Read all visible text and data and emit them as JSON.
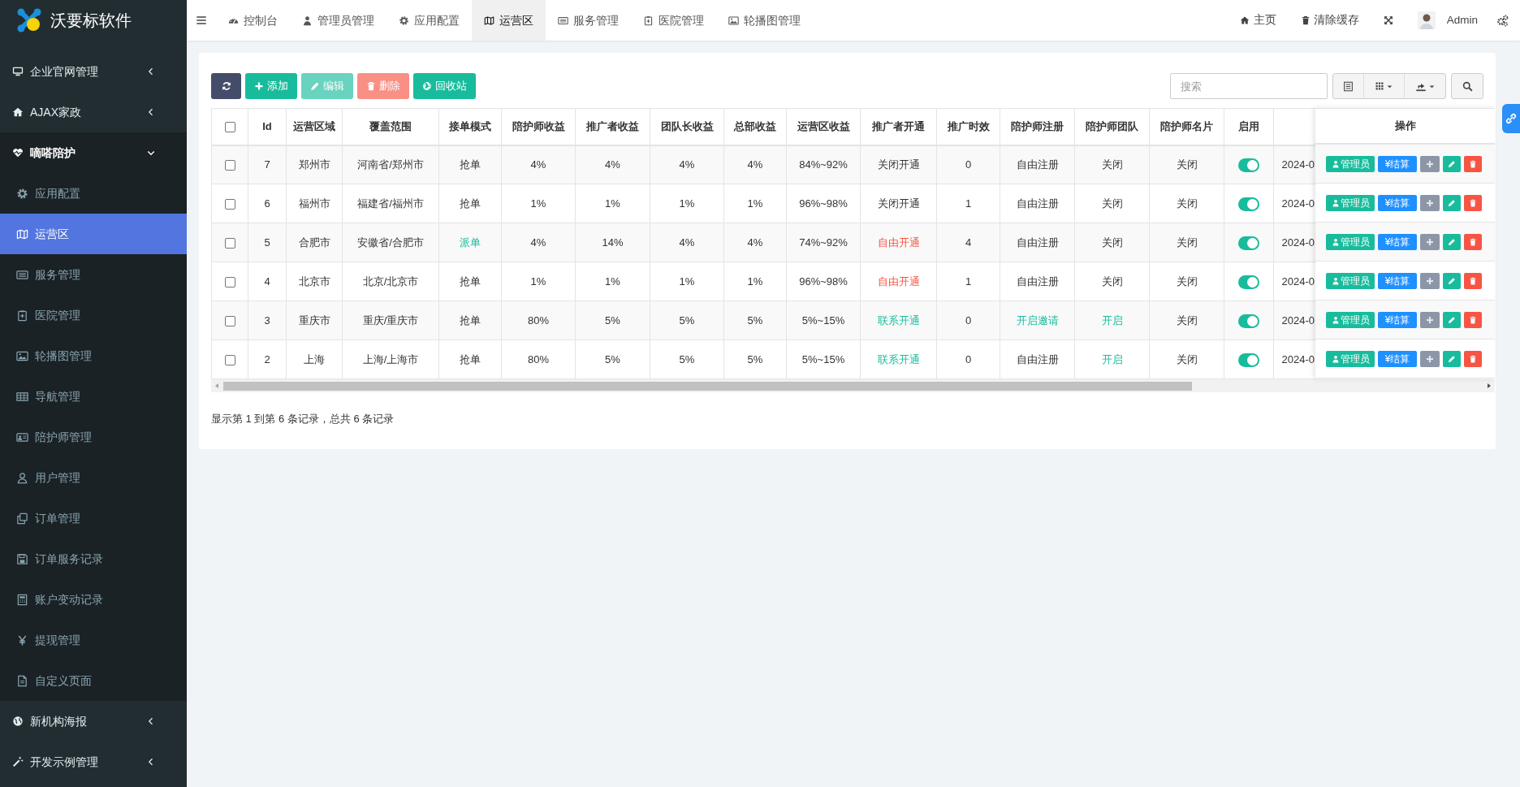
{
  "sidebar": {
    "logo_text": "沃要标软件",
    "items": [
      {
        "label": "企业官网管理",
        "expanded": false
      },
      {
        "label": "AJAX家政",
        "expanded": false
      },
      {
        "label": "嘀嗒陪护",
        "expanded": true,
        "children": [
          {
            "label": "应用配置",
            "selected": false
          },
          {
            "label": "运营区",
            "selected": true
          },
          {
            "label": "服务管理",
            "selected": false
          },
          {
            "label": "医院管理",
            "selected": false
          },
          {
            "label": "轮播图管理",
            "selected": false
          },
          {
            "label": "导航管理",
            "selected": false
          },
          {
            "label": "陪护师管理",
            "selected": false
          },
          {
            "label": "用户管理",
            "selected": false
          },
          {
            "label": "订单管理",
            "selected": false
          },
          {
            "label": "订单服务记录",
            "selected": false
          },
          {
            "label": "账户变动记录",
            "selected": false
          },
          {
            "label": "提现管理",
            "selected": false
          },
          {
            "label": "自定义页面",
            "selected": false
          }
        ]
      },
      {
        "label": "新机构海报",
        "expanded": false
      },
      {
        "label": "开发示例管理",
        "expanded": false
      }
    ]
  },
  "tabs": [
    {
      "label": "控制台",
      "selected": false
    },
    {
      "label": "管理员管理",
      "selected": false
    },
    {
      "label": "应用配置",
      "selected": false
    },
    {
      "label": "运营区",
      "selected": true
    },
    {
      "label": "服务管理",
      "selected": false
    },
    {
      "label": "医院管理",
      "selected": false
    },
    {
      "label": "轮播图管理",
      "selected": false
    }
  ],
  "top_right": {
    "home": "主页",
    "clear_cache": "清除缓存",
    "user": "Admin"
  },
  "toolbar": {
    "buttons": [
      {
        "kind": "refresh",
        "disabled": false
      },
      {
        "kind": "add",
        "label": "添加",
        "disabled": false
      },
      {
        "kind": "edit",
        "label": "编辑",
        "disabled": true
      },
      {
        "kind": "delete",
        "label": "删除",
        "disabled": true
      },
      {
        "kind": "recycle",
        "label": "回收站",
        "disabled": false
      }
    ],
    "search": {
      "placeholder": "搜索"
    }
  },
  "table": {
    "header_checked": false,
    "columns": [
      "Id",
      "运营区域",
      "覆盖范围",
      "接单模式",
      "陪护师收益",
      "推广者收益",
      "团队长收益",
      "总部收益",
      "运营区收益",
      "推广者开通",
      "推广时效",
      "陪护师注册",
      "陪护师团队",
      "陪护师名片",
      "启用"
    ],
    "actions_heading": "操作",
    "rows": [
      {
        "checked": false,
        "id": "7",
        "region": "郑州市",
        "coverage": "河南省/郑州市",
        "mode": {
          "text": "抢单",
          "color": "#333333"
        },
        "caregiver_income": "4%",
        "promoter_income": "4%",
        "leader_income": "4%",
        "hq_income": "4%",
        "region_income": "84%~92%",
        "promoter_open": {
          "text": "关闭开通",
          "color": "#333333"
        },
        "promotion_period": "0",
        "caregiver_registration": {
          "text": "自由注册",
          "color": "#333333"
        },
        "caregiver_team": {
          "text": "关闭",
          "color": "#333333"
        },
        "caregiver_card": "关闭",
        "enabled": true,
        "column_17": "2024-0",
        "actions": [
          {
            "kind": "admin",
            "label": "管理员"
          },
          {
            "kind": "settle",
            "label": "¥结算"
          },
          {
            "kind": "move"
          },
          {
            "kind": "edit"
          },
          {
            "kind": "delete"
          }
        ]
      },
      {
        "checked": false,
        "id": "6",
        "region": "福州市",
        "coverage": "福建省/福州市",
        "mode": {
          "text": "抢单",
          "color": "#333333"
        },
        "caregiver_income": "1%",
        "promoter_income": "1%",
        "leader_income": "1%",
        "hq_income": "1%",
        "region_income": "96%~98%",
        "promoter_open": {
          "text": "关闭开通",
          "color": "#333333"
        },
        "promotion_period": "1",
        "caregiver_registration": {
          "text": "自由注册",
          "color": "#333333"
        },
        "caregiver_team": {
          "text": "关闭",
          "color": "#333333"
        },
        "caregiver_card": "关闭",
        "enabled": true,
        "column_17": "2024-0",
        "actions": [
          {
            "kind": "admin",
            "label": "管理员"
          },
          {
            "kind": "settle",
            "label": "¥结算"
          },
          {
            "kind": "move"
          },
          {
            "kind": "edit"
          },
          {
            "kind": "delete"
          }
        ]
      },
      {
        "checked": false,
        "id": "5",
        "region": "合肥市",
        "coverage": "安徽省/合肥市",
        "mode": {
          "text": "派单",
          "color": "#18bc9c"
        },
        "caregiver_income": "4%",
        "promoter_income": "14%",
        "leader_income": "4%",
        "hq_income": "4%",
        "region_income": "74%~92%",
        "promoter_open": {
          "text": "自由开通",
          "color": "#f75444"
        },
        "promotion_period": "4",
        "caregiver_registration": {
          "text": "自由注册",
          "color": "#333333"
        },
        "caregiver_team": {
          "text": "关闭",
          "color": "#333333"
        },
        "caregiver_card": "关闭",
        "enabled": true,
        "column_17": "2024-0",
        "actions": [
          {
            "kind": "admin",
            "label": "管理员"
          },
          {
            "kind": "settle",
            "label": "¥结算"
          },
          {
            "kind": "move"
          },
          {
            "kind": "edit"
          },
          {
            "kind": "delete"
          }
        ]
      },
      {
        "checked": false,
        "id": "4",
        "region": "北京市",
        "coverage": "北京/北京市",
        "mode": {
          "text": "抢单",
          "color": "#333333"
        },
        "caregiver_income": "1%",
        "promoter_income": "1%",
        "leader_income": "1%",
        "hq_income": "1%",
        "region_income": "96%~98%",
        "promoter_open": {
          "text": "自由开通",
          "color": "#f75444"
        },
        "promotion_period": "1",
        "caregiver_registration": {
          "text": "自由注册",
          "color": "#333333"
        },
        "caregiver_team": {
          "text": "关闭",
          "color": "#333333"
        },
        "caregiver_card": "关闭",
        "enabled": true,
        "column_17": "2024-0",
        "actions": [
          {
            "kind": "admin",
            "label": "管理员"
          },
          {
            "kind": "settle",
            "label": "¥结算"
          },
          {
            "kind": "move"
          },
          {
            "kind": "edit"
          },
          {
            "kind": "delete"
          }
        ]
      },
      {
        "checked": false,
        "id": "3",
        "region": "重庆市",
        "coverage": "重庆/重庆市",
        "mode": {
          "text": "抢单",
          "color": "#333333"
        },
        "caregiver_income": "80%",
        "promoter_income": "5%",
        "leader_income": "5%",
        "hq_income": "5%",
        "region_income": "5%~15%",
        "promoter_open": {
          "text": "联系开通",
          "color": "#18bc9c"
        },
        "promotion_period": "0",
        "caregiver_registration": {
          "text": "开启邀请",
          "color": "#18bc9c"
        },
        "caregiver_team": {
          "text": "开启",
          "color": "#18bc9c"
        },
        "caregiver_card": "关闭",
        "enabled": true,
        "column_17": "2024-0",
        "actions": [
          {
            "kind": "admin",
            "label": "管理员"
          },
          {
            "kind": "settle",
            "label": "¥结算"
          },
          {
            "kind": "move"
          },
          {
            "kind": "edit"
          },
          {
            "kind": "delete"
          }
        ]
      },
      {
        "checked": false,
        "id": "2",
        "region": "上海",
        "coverage": "上海/上海市",
        "mode": {
          "text": "抢单",
          "color": "#333333"
        },
        "caregiver_income": "80%",
        "promoter_income": "5%",
        "leader_income": "5%",
        "hq_income": "5%",
        "region_income": "5%~15%",
        "promoter_open": {
          "text": "联系开通",
          "color": "#18bc9c"
        },
        "promotion_period": "0",
        "caregiver_registration": {
          "text": "自由注册",
          "color": "#333333"
        },
        "caregiver_team": {
          "text": "开启",
          "color": "#18bc9c"
        },
        "caregiver_card": "关闭",
        "enabled": true,
        "column_17": "2024-0",
        "actions": [
          {
            "kind": "admin",
            "label": "管理员"
          },
          {
            "kind": "settle",
            "label": "¥结算"
          },
          {
            "kind": "move"
          },
          {
            "kind": "edit"
          },
          {
            "kind": "delete"
          }
        ]
      }
    ]
  },
  "pagination_text": "显示第 1 到第 6 条记录，总共 6 条记录"
}
